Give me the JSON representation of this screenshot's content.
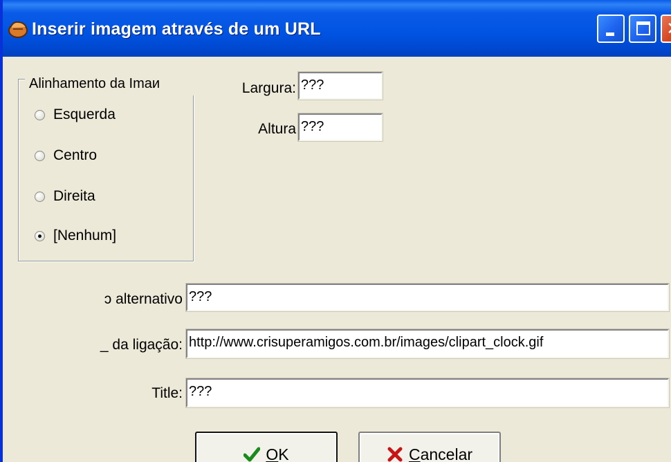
{
  "window": {
    "title": "Inserir imagem através de um URL"
  },
  "alignment_group": {
    "legend": "Alinhamento da Imaи",
    "options": [
      {
        "label": "Esquerda",
        "checked": false
      },
      {
        "label": "Centro",
        "checked": false
      },
      {
        "label": "Direita",
        "checked": false
      },
      {
        "label": "[Nenhum]",
        "checked": true
      }
    ]
  },
  "size": {
    "width_label": "Largura:",
    "width_value": "???",
    "height_label": "Altura",
    "height_value": "???"
  },
  "alt_text": {
    "label": "ɔ alternativo",
    "value": "???"
  },
  "link": {
    "label": "_ da ligação:",
    "value": "http://www.crisuperamigos.com.br/images/clipart_clock.gif"
  },
  "title_field": {
    "label": "Title:",
    "value": "???"
  },
  "buttons": {
    "ok_mnemonic": "O",
    "ok_rest": "K",
    "cancel_mnemonic": "C",
    "cancel_rest": "ancelar"
  },
  "icons": {
    "app": "hand-icon",
    "ok": "checkmark-icon",
    "cancel": "red-x-icon"
  },
  "colors": {
    "titlebar": "#0053e1",
    "dialog_bg": "#ece9d8",
    "ok_check": "#1a8a1a",
    "cancel_x": "#c81414"
  }
}
